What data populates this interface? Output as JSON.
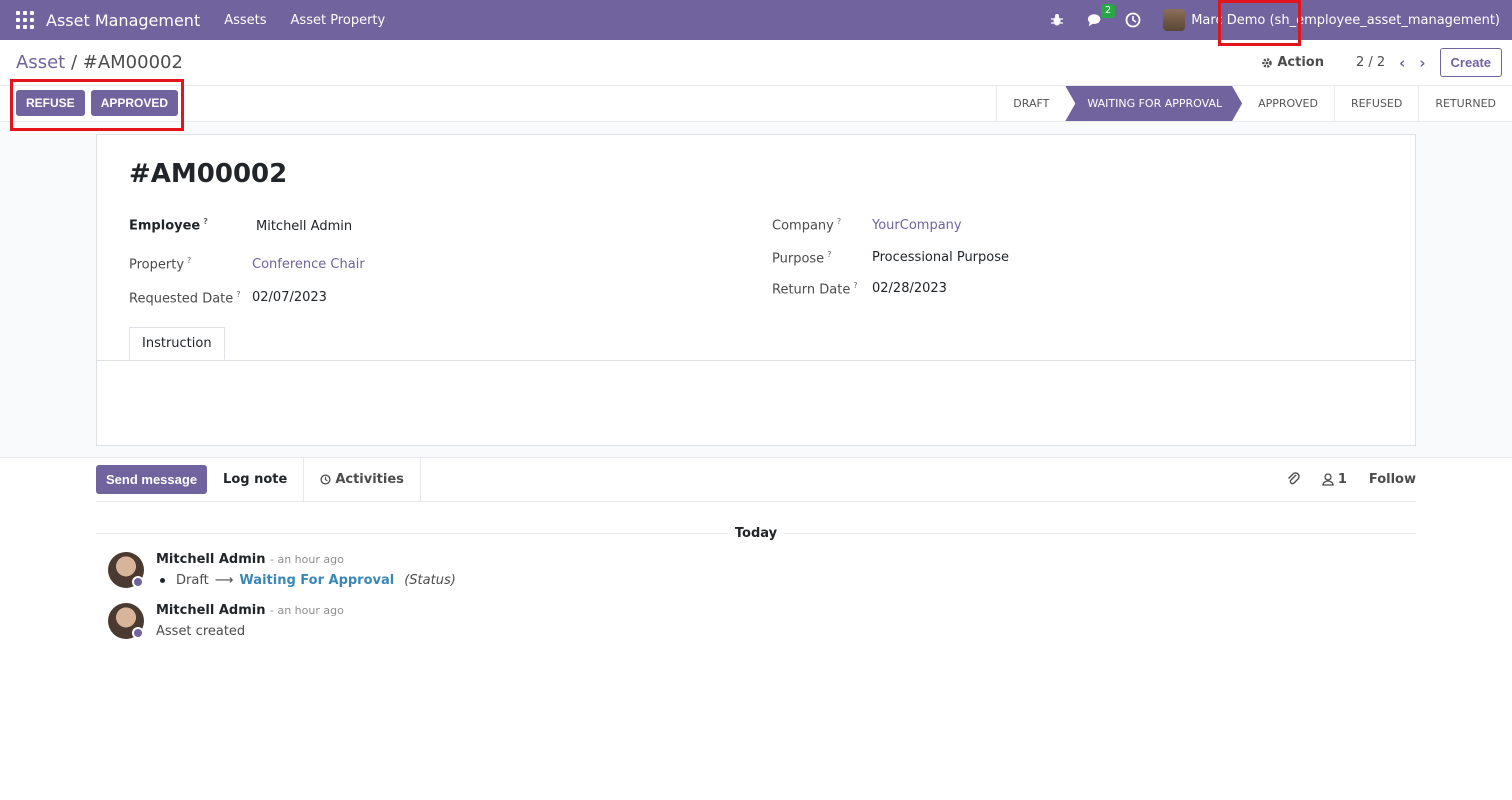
{
  "navbar": {
    "brand": "Asset Management",
    "menus": [
      "Assets",
      "Asset Property"
    ],
    "chat_badge": "2",
    "user_name": "Marc Demo (sh_employee_asset_management)"
  },
  "control": {
    "breadcrumb_parent": "Asset",
    "breadcrumb_sep": "/",
    "breadcrumb_current": "#AM00002",
    "action_label": "Action",
    "pager": "2 / 2",
    "create_label": "Create"
  },
  "statusbar": {
    "buttons": [
      "REFUSE",
      "APPROVED"
    ],
    "stages": [
      "DRAFT",
      "WAITING FOR APPROVAL",
      "APPROVED",
      "REFUSED",
      "RETURNED"
    ],
    "active_stage": "WAITING FOR APPROVAL"
  },
  "form": {
    "title": "#AM00002",
    "employee_label": "Employee",
    "employee_value": "Mitchell Admin",
    "property_label": "Property",
    "property_value": "Conference Chair",
    "requested_date_label": "Requested Date",
    "requested_date_value": "02/07/2023",
    "company_label": "Company",
    "company_value": "YourCompany",
    "purpose_label": "Purpose",
    "purpose_value": "Processional Purpose",
    "return_date_label": "Return Date",
    "return_date_value": "02/28/2023",
    "help_mark": "?",
    "tab_instruction": "Instruction"
  },
  "chatter": {
    "send_message": "Send message",
    "log_note": "Log note",
    "activities": "Activities",
    "followers_count": "1",
    "follow": "Follow",
    "today": "Today",
    "messages": [
      {
        "author": "Mitchell Admin",
        "time": "- an hour ago",
        "old_value": "Draft",
        "new_value": "Waiting For Approval",
        "field": "(Status)"
      },
      {
        "author": "Mitchell Admin",
        "time": "- an hour ago",
        "body": "Asset created"
      }
    ]
  },
  "colors": {
    "brand": "#71639e",
    "highlight": "#e3141c",
    "badge": "#28a745",
    "link_blue": "#3a87b8"
  }
}
